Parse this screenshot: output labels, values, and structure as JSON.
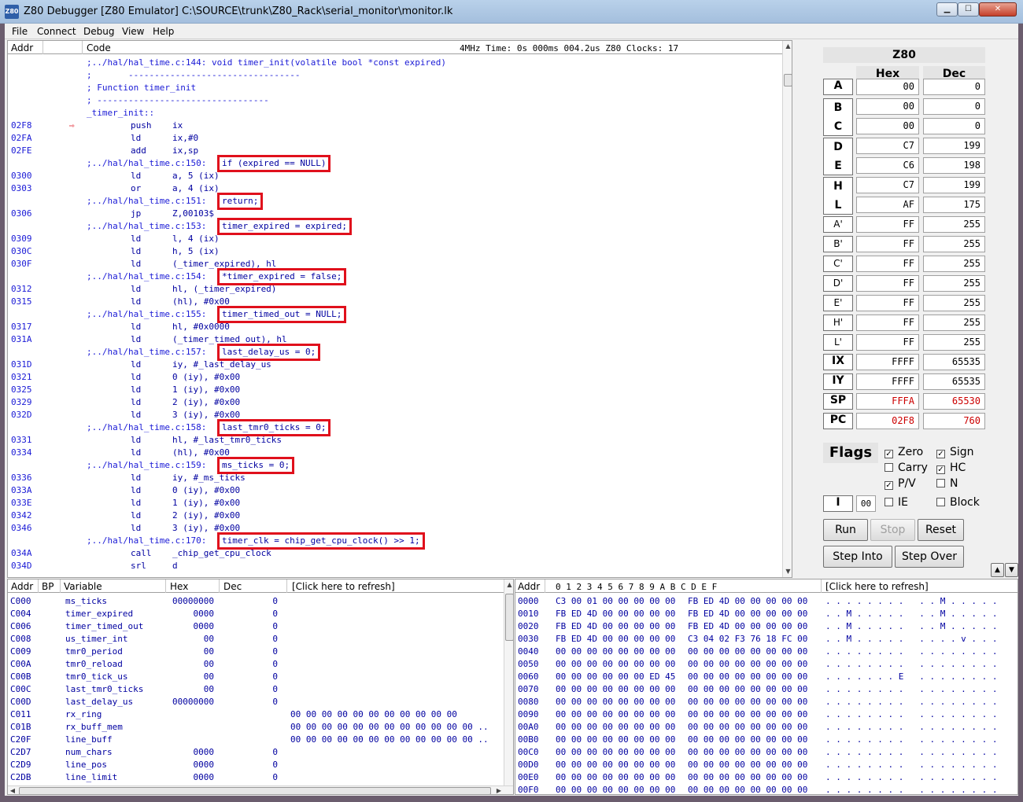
{
  "window": {
    "title": "Z80 Debugger [Z80 Emulator] C:\\SOURCE\\trunk\\Z80_Rack\\serial_monitor\\monitor.lk",
    "icon_label": "Z80",
    "minimize_icon": "minimize-icon",
    "maximize_icon": "maximize-icon",
    "close_icon": "close-icon"
  },
  "menu": [
    "File",
    "Connect",
    "Debug",
    "View",
    "Help"
  ],
  "code": {
    "headers": {
      "addr": "Addr",
      "code": "Code",
      "status": "4MHz Time: 0s 000ms 004.2us   Z80 Clocks: 17"
    },
    "pc_marker": "⇨",
    "lines": [
      {
        "addr": "",
        "text": ";../hal/hal_time.c:144: void timer_init(volatile bool *const expired)"
      },
      {
        "addr": "",
        "text": ";       ---------------------------------"
      },
      {
        "addr": "",
        "text": "; Function timer_init"
      },
      {
        "addr": "",
        "text": "; ---------------------------------"
      },
      {
        "addr": "",
        "text": "_timer_init::"
      },
      {
        "addr": "02F8",
        "ins": "push    ix",
        "pc": true
      },
      {
        "addr": "02FA",
        "ins": "ld      ix,#0"
      },
      {
        "addr": "02FE",
        "ins": "add     ix,sp"
      },
      {
        "addr": "",
        "text": ";../hal/hal_time.c:150:",
        "src": "if (expired == NULL)"
      },
      {
        "addr": "0300",
        "ins": "ld      a, 5 (ix)"
      },
      {
        "addr": "0303",
        "ins": "or      a, 4 (ix)"
      },
      {
        "addr": "",
        "text": ";../hal/hal_time.c:151:",
        "src": "return;"
      },
      {
        "addr": "0306",
        "ins": "jp      Z,00103$"
      },
      {
        "addr": "",
        "text": ";../hal/hal_time.c:153:",
        "src": "timer_expired = expired;"
      },
      {
        "addr": "0309",
        "ins": "ld      l, 4 (ix)"
      },
      {
        "addr": "030C",
        "ins": "ld      h, 5 (ix)"
      },
      {
        "addr": "030F",
        "ins": "ld      (_timer_expired), hl"
      },
      {
        "addr": "",
        "text": ";../hal/hal_time.c:154:",
        "src": "*timer_expired = false;"
      },
      {
        "addr": "0312",
        "ins": "ld      hl, (_timer_expired)"
      },
      {
        "addr": "0315",
        "ins": "ld      (hl), #0x00"
      },
      {
        "addr": "",
        "text": ";../hal/hal_time.c:155:",
        "src": "timer_timed_out = NULL;"
      },
      {
        "addr": "0317",
        "ins": "ld      hl, #0x0000"
      },
      {
        "addr": "031A",
        "ins": "ld      (_timer_timed_out), hl"
      },
      {
        "addr": "",
        "text": ";../hal/hal_time.c:157:",
        "src": "last_delay_us = 0;"
      },
      {
        "addr": "031D",
        "ins": "ld      iy, #_last_delay_us"
      },
      {
        "addr": "0321",
        "ins": "ld      0 (iy), #0x00"
      },
      {
        "addr": "0325",
        "ins": "ld      1 (iy), #0x00"
      },
      {
        "addr": "0329",
        "ins": "ld      2 (iy), #0x00"
      },
      {
        "addr": "032D",
        "ins": "ld      3 (iy), #0x00"
      },
      {
        "addr": "",
        "text": ";../hal/hal_time.c:158:",
        "src": "last_tmr0_ticks = 0;"
      },
      {
        "addr": "0331",
        "ins": "ld      hl, #_last_tmr0_ticks"
      },
      {
        "addr": "0334",
        "ins": "ld      (hl), #0x00"
      },
      {
        "addr": "",
        "text": ";../hal/hal_time.c:159:",
        "src": "ms_ticks = 0;"
      },
      {
        "addr": "0336",
        "ins": "ld      iy, #_ms_ticks"
      },
      {
        "addr": "033A",
        "ins": "ld      0 (iy), #0x00"
      },
      {
        "addr": "033E",
        "ins": "ld      1 (iy), #0x00"
      },
      {
        "addr": "0342",
        "ins": "ld      2 (iy), #0x00"
      },
      {
        "addr": "0346",
        "ins": "ld      3 (iy), #0x00"
      },
      {
        "addr": "",
        "text": ";../hal/hal_time.c:170:",
        "src": "timer_clk = chip_get_cpu_clock() >> 1;"
      },
      {
        "addr": "034A",
        "ins": "call    _chip_get_cpu_clock"
      },
      {
        "addr": "034D",
        "ins": "srl     d"
      }
    ]
  },
  "registers": {
    "title": "Z80",
    "hex_header": "Hex",
    "dec_header": "Dec",
    "rows": [
      {
        "name": "A",
        "hex": "00",
        "dec": "0"
      },
      {
        "name": "B",
        "hex": "00",
        "dec": "0"
      },
      {
        "name": "C",
        "hex": "00",
        "dec": "0"
      },
      {
        "name": "D",
        "hex": "C7",
        "dec": "199"
      },
      {
        "name": "E",
        "hex": "C6",
        "dec": "198"
      },
      {
        "name": "H",
        "hex": "C7",
        "dec": "199"
      },
      {
        "name": "L",
        "hex": "AF",
        "dec": "175"
      },
      {
        "name": "A'",
        "hex": "FF",
        "dec": "255"
      },
      {
        "name": "B'",
        "hex": "FF",
        "dec": "255"
      },
      {
        "name": "C'",
        "hex": "FF",
        "dec": "255"
      },
      {
        "name": "D'",
        "hex": "FF",
        "dec": "255"
      },
      {
        "name": "E'",
        "hex": "FF",
        "dec": "255"
      },
      {
        "name": "H'",
        "hex": "FF",
        "dec": "255"
      },
      {
        "name": "L'",
        "hex": "FF",
        "dec": "255"
      },
      {
        "name": "IX",
        "hex": "FFFF",
        "dec": "65535"
      },
      {
        "name": "IY",
        "hex": "FFFF",
        "dec": "65535"
      },
      {
        "name": "SP",
        "hex": "FFFA",
        "dec": "65530",
        "changed": true
      },
      {
        "name": "PC",
        "hex": "02F8",
        "dec": "760",
        "changed": true
      }
    ],
    "flags_label": "Flags",
    "flags": [
      {
        "name": "Zero",
        "checked": true
      },
      {
        "name": "Sign",
        "checked": true
      },
      {
        "name": "Carry",
        "checked": false
      },
      {
        "name": "HC",
        "checked": true
      },
      {
        "name": "P/V",
        "checked": true
      },
      {
        "name": "N",
        "checked": false
      }
    ],
    "i_label": "I",
    "i_value": "00",
    "ie": {
      "name": "IE",
      "checked": false
    },
    "block": {
      "name": "Block",
      "checked": false
    },
    "buttons": {
      "run": "Run",
      "stop": "Stop",
      "reset": "Reset",
      "step_into": "Step Into",
      "step_over": "Step Over"
    }
  },
  "variables": {
    "headers": {
      "addr": "Addr",
      "bp": "BP",
      "variable": "Variable",
      "hex": "Hex",
      "dec": "Dec",
      "refresh": "[Click here to refresh]"
    },
    "rows": [
      {
        "addr": "C000",
        "name": "ms_ticks",
        "hex": "00000000",
        "dec": "0",
        "data": ""
      },
      {
        "addr": "C004",
        "name": "timer_expired",
        "hex": "0000",
        "dec": "0",
        "data": ""
      },
      {
        "addr": "C006",
        "name": "timer_timed_out",
        "hex": "0000",
        "dec": "0",
        "data": ""
      },
      {
        "addr": "C008",
        "name": "us_timer_int",
        "hex": "00",
        "dec": "0",
        "data": ""
      },
      {
        "addr": "C009",
        "name": "tmr0_period",
        "hex": "00",
        "dec": "0",
        "data": ""
      },
      {
        "addr": "C00A",
        "name": "tmr0_reload",
        "hex": "00",
        "dec": "0",
        "data": ""
      },
      {
        "addr": "C00B",
        "name": "tmr0_tick_us",
        "hex": "00",
        "dec": "0",
        "data": ""
      },
      {
        "addr": "C00C",
        "name": "last_tmr0_ticks",
        "hex": "00",
        "dec": "0",
        "data": ""
      },
      {
        "addr": "C00D",
        "name": "last_delay_us",
        "hex": "00000000",
        "dec": "0",
        "data": ""
      },
      {
        "addr": "C011",
        "name": "rx_ring",
        "hex": "",
        "dec": "",
        "data": "00 00 00 00 00 00 00 00 00 00 00"
      },
      {
        "addr": "C01B",
        "name": "rx_buff_mem",
        "hex": "",
        "dec": "",
        "data": "00 00 00 00 00 00 00 00 00 00 00 00 .."
      },
      {
        "addr": "C20F",
        "name": "line_buff",
        "hex": "",
        "dec": "",
        "data": "00 00 00 00 00 00 00 00 00 00 00 00 .."
      },
      {
        "addr": "C2D7",
        "name": "num_chars",
        "hex": "0000",
        "dec": "0",
        "data": ""
      },
      {
        "addr": "C2D9",
        "name": "line_pos",
        "hex": "0000",
        "dec": "0",
        "data": ""
      },
      {
        "addr": "C2DB",
        "name": "line_limit",
        "hex": "0000",
        "dec": "0",
        "data": ""
      }
    ]
  },
  "memory": {
    "headers": {
      "addr": "Addr",
      "cols": "0  1  2  3  4  5  6  7   8  9  A  B  C  D  E  F",
      "refresh": "[Click here to refresh]"
    },
    "rows": [
      {
        "addr": "0000",
        "lo": "C3 00 01 00 00 00 00 00",
        "hi": "FB ED 4D 00 00 00 00 00",
        "ascii": ". . . . . . . .   . . M . . . . ."
      },
      {
        "addr": "0010",
        "lo": "FB ED 4D 00 00 00 00 00",
        "hi": "FB ED 4D 00 00 00 00 00",
        "ascii": ". . M . . . . .   . . M . . . . ."
      },
      {
        "addr": "0020",
        "lo": "FB ED 4D 00 00 00 00 00",
        "hi": "FB ED 4D 00 00 00 00 00",
        "ascii": ". . M . . . . .   . . M . . . . ."
      },
      {
        "addr": "0030",
        "lo": "FB ED 4D 00 00 00 00 00",
        "hi": "C3 04 02 F3 76 18 FC 00",
        "ascii": ". . M . . . . .   . . . . v . . ."
      },
      {
        "addr": "0040",
        "lo": "00 00 00 00 00 00 00 00",
        "hi": "00 00 00 00 00 00 00 00",
        "ascii": ". . . . . . . .   . . . . . . . ."
      },
      {
        "addr": "0050",
        "lo": "00 00 00 00 00 00 00 00",
        "hi": "00 00 00 00 00 00 00 00",
        "ascii": ". . . . . . . .   . . . . . . . ."
      },
      {
        "addr": "0060",
        "lo": "00 00 00 00 00 00 ED 45",
        "hi": "00 00 00 00 00 00 00 00",
        "ascii": ". . . . . . . E   . . . . . . . ."
      },
      {
        "addr": "0070",
        "lo": "00 00 00 00 00 00 00 00",
        "hi": "00 00 00 00 00 00 00 00",
        "ascii": ". . . . . . . .   . . . . . . . ."
      },
      {
        "addr": "0080",
        "lo": "00 00 00 00 00 00 00 00",
        "hi": "00 00 00 00 00 00 00 00",
        "ascii": ". . . . . . . .   . . . . . . . ."
      },
      {
        "addr": "0090",
        "lo": "00 00 00 00 00 00 00 00",
        "hi": "00 00 00 00 00 00 00 00",
        "ascii": ". . . . . . . .   . . . . . . . ."
      },
      {
        "addr": "00A0",
        "lo": "00 00 00 00 00 00 00 00",
        "hi": "00 00 00 00 00 00 00 00",
        "ascii": ". . . . . . . .   . . . . . . . ."
      },
      {
        "addr": "00B0",
        "lo": "00 00 00 00 00 00 00 00",
        "hi": "00 00 00 00 00 00 00 00",
        "ascii": ". . . . . . . .   . . . . . . . ."
      },
      {
        "addr": "00C0",
        "lo": "00 00 00 00 00 00 00 00",
        "hi": "00 00 00 00 00 00 00 00",
        "ascii": ". . . . . . . .   . . . . . . . ."
      },
      {
        "addr": "00D0",
        "lo": "00 00 00 00 00 00 00 00",
        "hi": "00 00 00 00 00 00 00 00",
        "ascii": ". . . . . . . .   . . . . . . . ."
      },
      {
        "addr": "00E0",
        "lo": "00 00 00 00 00 00 00 00",
        "hi": "00 00 00 00 00 00 00 00",
        "ascii": ". . . . . . . .   . . . . . . . ."
      },
      {
        "addr": "00F0",
        "lo": "00 00 00 00 00 00 00 00",
        "hi": "00 00 00 00 00 00 00 00",
        "ascii": ". . . . . . . .   . . . . . . . ."
      }
    ]
  }
}
